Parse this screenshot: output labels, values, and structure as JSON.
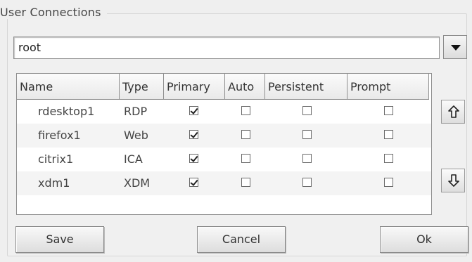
{
  "group": {
    "title": "User Connections"
  },
  "user_combo": {
    "value": "root"
  },
  "table": {
    "columns": [
      "Name",
      "Type",
      "Primary",
      "Auto",
      "Persistent",
      "Prompt"
    ],
    "rows": [
      {
        "name": "rdesktop1",
        "type": "RDP",
        "primary": true,
        "auto": false,
        "persistent": false,
        "prompt": false
      },
      {
        "name": "firefox1",
        "type": "Web",
        "primary": true,
        "auto": false,
        "persistent": false,
        "prompt": false
      },
      {
        "name": "citrix1",
        "type": "ICA",
        "primary": true,
        "auto": false,
        "persistent": false,
        "prompt": false
      },
      {
        "name": "xdm1",
        "type": "XDM",
        "primary": true,
        "auto": false,
        "persistent": false,
        "prompt": false
      }
    ]
  },
  "buttons": {
    "save": "Save",
    "cancel": "Cancel",
    "ok": "Ok"
  },
  "icons": {
    "move_up": "arrow-up-icon",
    "move_down": "arrow-down-icon",
    "dropdown": "chevron-down-icon"
  }
}
